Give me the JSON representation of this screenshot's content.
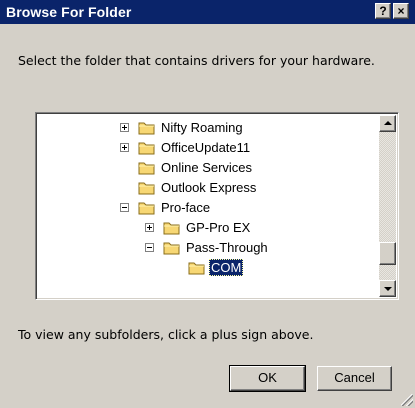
{
  "window": {
    "title": "Browse For Folder",
    "help_button": "?",
    "close_button": "×"
  },
  "instruction": "Select the folder that contains drivers for your hardware.",
  "tree": {
    "items": [
      {
        "label": "Nifty Roaming",
        "expander": "plus",
        "level": 0,
        "selected": false
      },
      {
        "label": "OfficeUpdate11",
        "expander": "plus",
        "level": 0,
        "selected": false
      },
      {
        "label": "Online Services",
        "expander": "none",
        "level": 0,
        "selected": false
      },
      {
        "label": "Outlook Express",
        "expander": "none",
        "level": 0,
        "selected": false
      },
      {
        "label": "Pro-face",
        "expander": "minus",
        "level": 0,
        "selected": false
      },
      {
        "label": "GP-Pro EX",
        "expander": "plus",
        "level": 1,
        "selected": false
      },
      {
        "label": "Pass-Through",
        "expander": "minus",
        "level": 1,
        "selected": false
      },
      {
        "label": "COM",
        "expander": "none",
        "level": 2,
        "selected": true
      }
    ]
  },
  "hint": "To view any subfolders, click a plus sign above.",
  "buttons": {
    "ok": "OK",
    "cancel": "Cancel"
  },
  "colors": {
    "titlebar": "#0a246a",
    "selection": "#0a246a",
    "face": "#d4d0c8",
    "folder": "#f7d774"
  }
}
